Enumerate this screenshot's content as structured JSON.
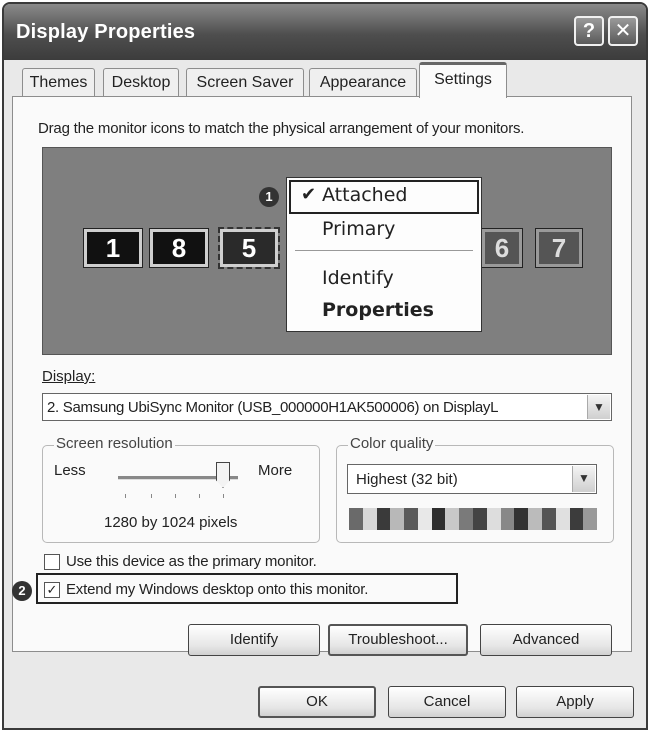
{
  "window": {
    "title": "Display Properties",
    "help_label": "?",
    "close_label": "✕"
  },
  "tabs": [
    {
      "label": "Themes"
    },
    {
      "label": "Desktop"
    },
    {
      "label": "Screen Saver"
    },
    {
      "label": "Appearance"
    },
    {
      "label": "Settings",
      "active": true
    }
  ],
  "instruction": "Drag the monitor icons to match the physical arrangement of your monitors.",
  "monitors": [
    {
      "label": "1"
    },
    {
      "label": "8"
    },
    {
      "label": "5"
    },
    {
      "label": "6"
    },
    {
      "label": "7"
    }
  ],
  "context_menu": {
    "items": [
      {
        "label": "Attached",
        "checked": true
      },
      {
        "label": "Primary"
      },
      {
        "label": "Identify"
      },
      {
        "label": "Properties",
        "bold": true
      }
    ],
    "check_glyph": "✔"
  },
  "callouts": [
    "1",
    "2"
  ],
  "display": {
    "label": "Display:",
    "value": "2. Samsung UbiSync Monitor (USB_000000H1AK500006) on DisplayL"
  },
  "resolution": {
    "title": "Screen resolution",
    "less": "Less",
    "more": "More",
    "value_text": "1280 by 1024 pixels",
    "slider_fraction": 0.85
  },
  "color_quality": {
    "title": "Color quality",
    "value": "Highest (32 bit)"
  },
  "options": {
    "primary_monitor": {
      "label": "Use this device as the primary monitor.",
      "checked": false
    },
    "extend_desktop": {
      "label": "Extend my Windows desktop onto this monitor.",
      "checked": true,
      "check_glyph": "✓"
    }
  },
  "buttons": {
    "identify": "Identify",
    "troubleshoot": "Troubleshoot...",
    "advanced": "Advanced",
    "ok": "OK",
    "cancel": "Cancel",
    "apply": "Apply"
  },
  "dropdown_glyph": "▼"
}
